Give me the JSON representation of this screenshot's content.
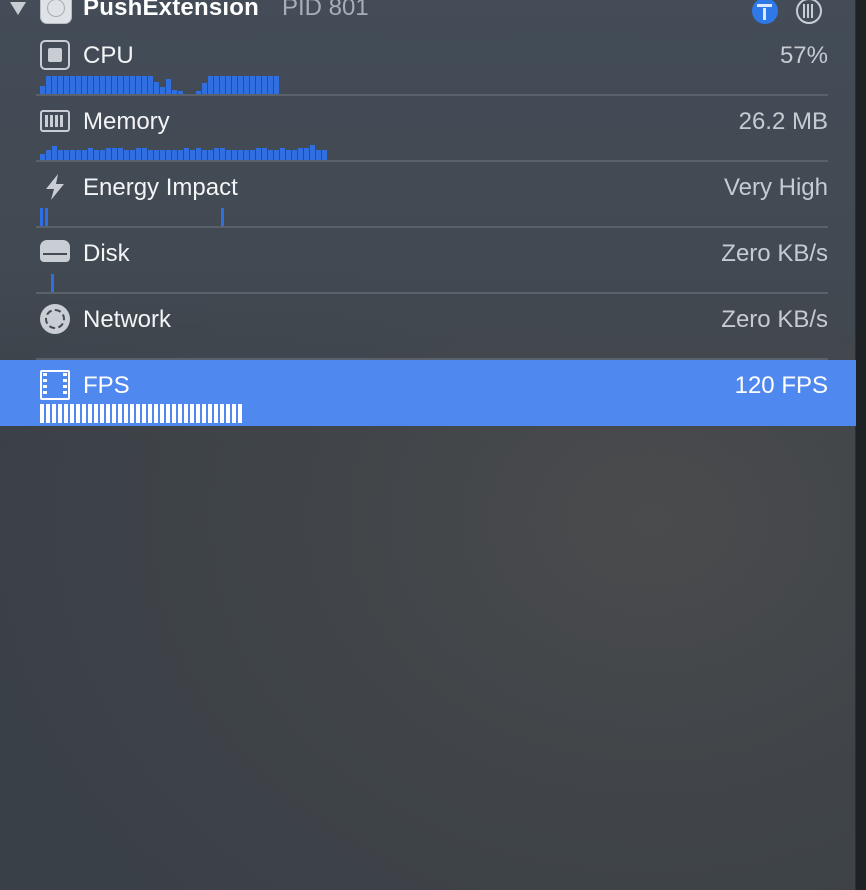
{
  "header": {
    "app_name": "PushExtension",
    "pid": "PID 801",
    "icons": {
      "app": "app-icon",
      "debug": "debug-navigator-icon",
      "pause": "pause-icon",
      "disclosure": "disclosure-triangle-icon"
    }
  },
  "gauges": [
    {
      "id": "cpu",
      "label": "CPU",
      "value": "57%",
      "icon": "cpu-icon",
      "history": [
        6,
        13,
        13,
        13,
        13,
        13,
        13,
        13,
        13,
        13,
        13,
        13,
        13,
        13,
        13,
        13,
        13,
        13,
        13,
        9,
        5,
        11,
        3,
        2,
        0,
        0,
        2,
        8,
        13,
        13,
        13,
        13,
        13,
        13,
        13,
        13,
        13,
        13,
        13,
        13
      ]
    },
    {
      "id": "memory",
      "label": "Memory",
      "value": "26.2 MB",
      "icon": "memory-chip-icon",
      "history": [
        4,
        7,
        10,
        7,
        7,
        7,
        7,
        7,
        9,
        7,
        7,
        9,
        9,
        9,
        7,
        7,
        9,
        9,
        7,
        7,
        7,
        7,
        7,
        7,
        9,
        7,
        9,
        7,
        7,
        9,
        9,
        7,
        7,
        7,
        7,
        7,
        9,
        9,
        7,
        7,
        9,
        7,
        7,
        9,
        9,
        11,
        7,
        7
      ]
    },
    {
      "id": "energy",
      "label": "Energy Impact",
      "value": "Very High",
      "icon": "lightning-bolt-icon"
    },
    {
      "id": "disk",
      "label": "Disk",
      "value": "Zero KB/s",
      "icon": "disk-drive-icon"
    },
    {
      "id": "network",
      "label": "Network",
      "value": "Zero KB/s",
      "icon": "network-globe-icon"
    },
    {
      "id": "fps",
      "label": "FPS",
      "value": "120 FPS",
      "icon": "film-strip-icon",
      "selected": true
    }
  ],
  "colors": {
    "accent": "#4f88ee",
    "bar": "#2f6fe0",
    "background": "#414952"
  }
}
